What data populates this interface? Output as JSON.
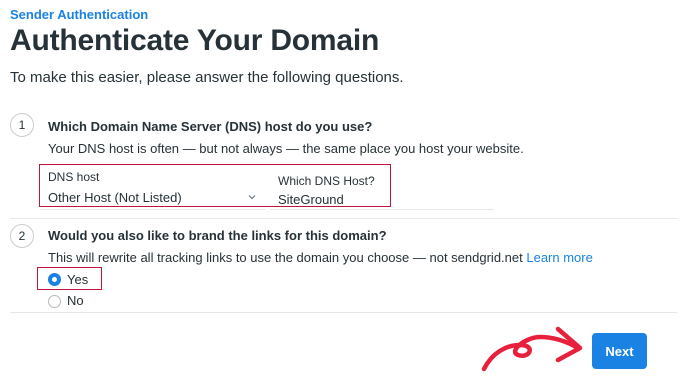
{
  "header": {
    "breadcrumb": "Sender Authentication",
    "title": "Authenticate Your Domain",
    "intro": "To make this easier, please answer the following questions."
  },
  "question1": {
    "number": "1",
    "title": "Which Domain Name Server (DNS) host do you use?",
    "description": "Your DNS host is often — but not always — the same place you host your website.",
    "dns_host_label": "DNS host",
    "dns_host_value": "Other Host (Not Listed)",
    "which_host_label": "Which DNS Host?",
    "which_host_value": "SiteGround"
  },
  "question2": {
    "number": "2",
    "title": "Would you also like to brand the links for this domain?",
    "description": "This will rewrite all tracking links to use the domain you choose — not sendgrid.net",
    "learn_more": "Learn more",
    "options": [
      {
        "label": "Yes",
        "selected": true
      },
      {
        "label": "No",
        "selected": false
      }
    ]
  },
  "footer": {
    "next_label": "Next"
  },
  "colors": {
    "accent": "#1a82e2",
    "highlight": "#c0143c",
    "annotation_arrow": "#e8203c"
  }
}
